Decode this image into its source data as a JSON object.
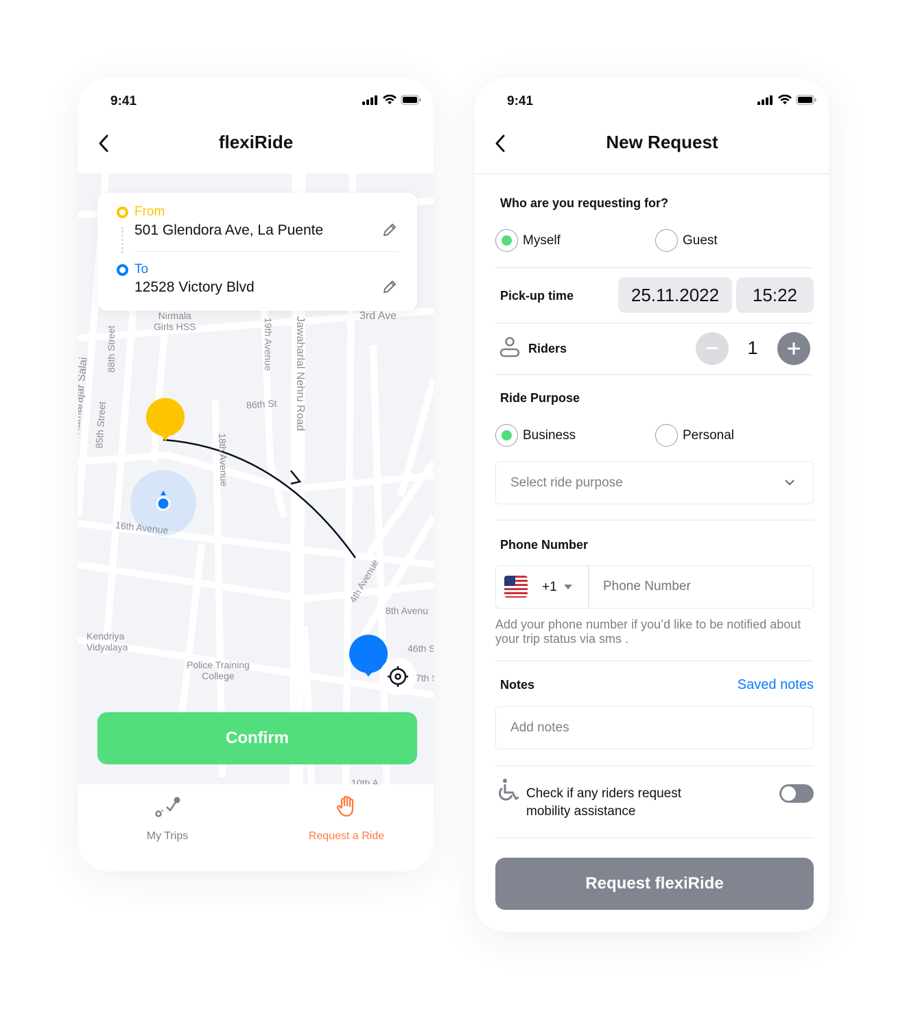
{
  "colors": {
    "accent_green": "#52DE7C",
    "from_yellow": "#FFC400",
    "to_blue": "#0A7AFF",
    "active_orange": "#FF7A3D",
    "disabled_gray": "#80858F"
  },
  "left": {
    "status_time": "9:41",
    "title": "flexiRide",
    "route": {
      "from_label": "From",
      "from_address": "501 Glendora Ave, La Puente",
      "to_label": "To",
      "to_address": "12528 Victory Blvd"
    },
    "map_labels": [
      "Nirmala\nGirls HSS",
      "3rd Ave",
      "88th Street",
      "19th Avenue",
      "Jawaharlal Nehru Road",
      "Kamarajar Salai",
      "85th Street",
      "86th St",
      "18th Avenue",
      "16th Avenue",
      "4th Avenue",
      "8th Avenu",
      "46th S",
      "7th S",
      "Kendriya\nVidyalaya",
      "Police Training\nCollege",
      "10th A"
    ],
    "confirm_label": "Confirm",
    "nav": [
      {
        "label": "My Trips",
        "icon": "route-icon",
        "active": false
      },
      {
        "label": "Request a Ride",
        "icon": "hand-icon",
        "active": true
      }
    ]
  },
  "right": {
    "status_time": "9:41",
    "title": "New Request",
    "requesting_for": {
      "label": "Who are you requesting for?",
      "options": [
        {
          "label": "Myself",
          "selected": true
        },
        {
          "label": "Guest",
          "selected": false
        }
      ]
    },
    "pickup": {
      "label": "Pick-up time",
      "date": "25.11.2022",
      "time": "15:22"
    },
    "riders": {
      "label": "Riders",
      "count": "1"
    },
    "purpose": {
      "label": "Ride Purpose",
      "options": [
        {
          "label": "Business",
          "selected": true
        },
        {
          "label": "Personal",
          "selected": false
        }
      ],
      "select_placeholder": "Select ride purpose"
    },
    "phone": {
      "label": "Phone Number",
      "country_code": "+1",
      "placeholder": "Phone Number",
      "hint": "Add your phone number if you’d like to be notified about your trip status via sms ."
    },
    "notes": {
      "label": "Notes",
      "saved_link": "Saved notes",
      "placeholder": "Add notes"
    },
    "mobility": {
      "label": "Check if any riders request mobility assistance",
      "enabled": false
    },
    "submit_label": "Request flexiRide"
  }
}
